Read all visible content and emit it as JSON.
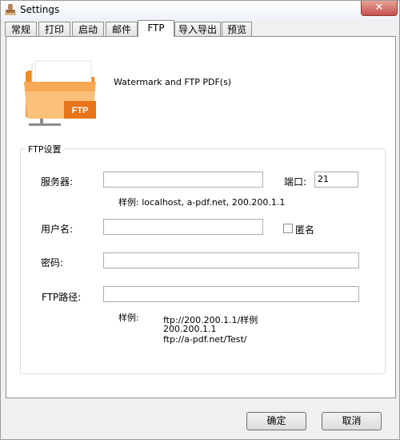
{
  "window": {
    "title": "Settings",
    "close_glyph": "✕"
  },
  "tabs": [
    {
      "label": "常规"
    },
    {
      "label": "打印"
    },
    {
      "label": "启动"
    },
    {
      "label": "邮件"
    },
    {
      "label": "FTP"
    },
    {
      "label": "导入导出"
    },
    {
      "label": "预览"
    }
  ],
  "active_tab": "FTP",
  "header": {
    "icon_badge": "FTP",
    "description": "Watermark and FTP PDF(s)"
  },
  "ftp_group": {
    "legend": "FTP设置",
    "server_label": "服务器:",
    "server_value": "",
    "port_label": "端口:",
    "port_value": "21",
    "server_hint": "样例: localhost, a-pdf.net, 200.200.1.1",
    "username_label": "用户名:",
    "username_value": "",
    "anonymous_label": "匿名",
    "anonymous_checked": false,
    "password_label": "密码:",
    "password_value": "",
    "path_label": "FTP路径:",
    "path_value": "",
    "path_hint_label": "样例:",
    "path_hint_lines": [
      "ftp://200.200.1.1/样例",
      "200.200.1.1",
      "ftp://a-pdf.net/Test/"
    ]
  },
  "buttons": {
    "ok": "确定",
    "cancel": "取消"
  },
  "colors": {
    "folder_orange": "#f08a24",
    "folder_light": "#fbc07a",
    "badge": "#e8741a"
  }
}
